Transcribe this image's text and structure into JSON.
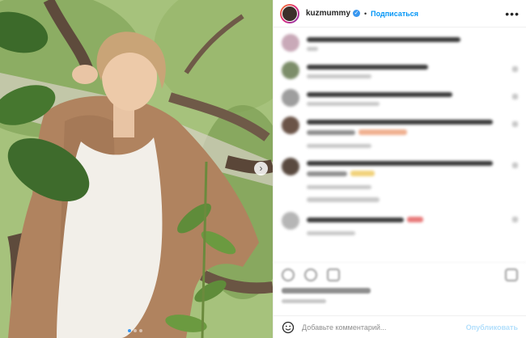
{
  "header": {
    "username": "kuzmummy",
    "separator": "•",
    "follow_label": "Подписаться",
    "more_label": "•••"
  },
  "photo": {
    "next_label": "›",
    "slides_total": 3,
    "slide_active": 1
  },
  "comments": [
    {
      "avatar_color": "#c9a9b8"
    },
    {
      "avatar_color": "#7d8e6a"
    },
    {
      "avatar_color": "#9e9e9e"
    },
    {
      "avatar_color": "#6b5448"
    },
    {
      "avatar_color": "#5a4a40"
    },
    {
      "avatar_color": "#b6b6b6"
    }
  ],
  "add_comment": {
    "placeholder": "Добавьте комментарий...",
    "publish_label": "Опубликовать"
  },
  "colors": {
    "accent": "#0095f6",
    "verified": "#3897f0",
    "border": "#efefef"
  }
}
